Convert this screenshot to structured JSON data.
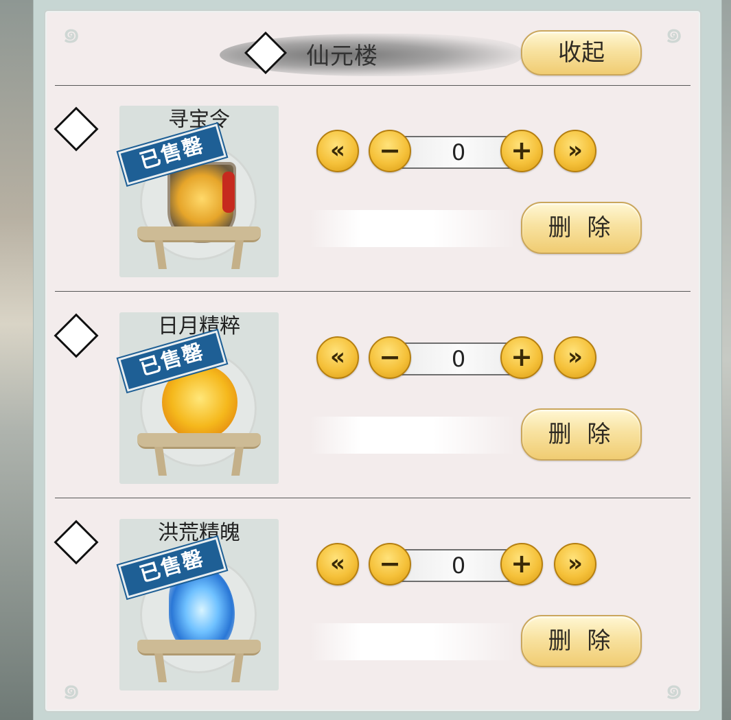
{
  "header": {
    "title": "仙元楼",
    "collapse_label": "收起"
  },
  "items": [
    {
      "name": "寻宝令",
      "stamp": "已售罄",
      "quantity": "0",
      "delete_label": "删 除"
    },
    {
      "name": "日月精粹",
      "stamp": "已售罄",
      "quantity": "0",
      "delete_label": "删 除"
    },
    {
      "name": "洪荒精魄",
      "stamp": "已售罄",
      "quantity": "0",
      "delete_label": "删 除"
    }
  ],
  "controls": {
    "min_glyph": "«",
    "dec_glyph": "−",
    "inc_glyph": "+",
    "max_glyph": "»"
  },
  "icons": [
    "diamond-checkbox-icon",
    "corner-ornament-icon",
    "stand-icon"
  ],
  "colors": {
    "panel_bg": "#f3ecec",
    "frame": "#c7d6d3",
    "gold_button": "#f0cc72",
    "stamp_blue": "#1e5f95"
  }
}
